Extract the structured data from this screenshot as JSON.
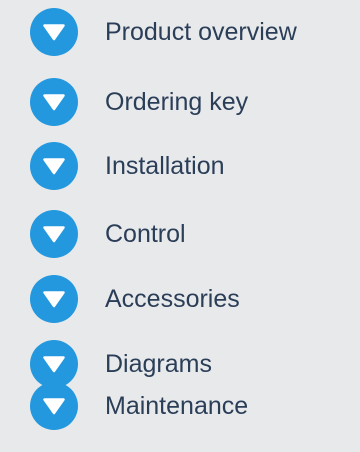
{
  "nav": {
    "items": [
      {
        "label": "Product overview",
        "icon": "chevron-down-icon"
      },
      {
        "label": "Ordering key",
        "icon": "chevron-down-icon"
      },
      {
        "label": "Installation",
        "icon": "chevron-down-icon"
      },
      {
        "label": "Control",
        "icon": "chevron-down-icon"
      },
      {
        "label": "Accessories",
        "icon": "chevron-down-icon"
      },
      {
        "label": "Diagrams",
        "icon": "chevron-down-icon"
      },
      {
        "label": "Maintenance",
        "icon": "chevron-down-icon"
      }
    ]
  },
  "colors": {
    "background": "#e8e9eb",
    "icon_circle": "#2398df",
    "icon_glyph": "#ffffff",
    "label": "#2b3e58"
  }
}
